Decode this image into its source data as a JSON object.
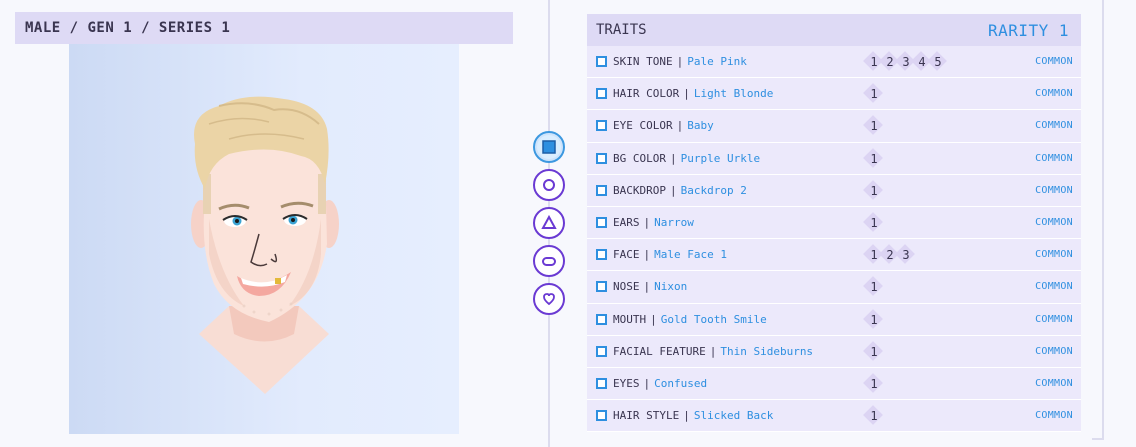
{
  "breadcrumb": "MALE / GEN 1 / SERIES 1",
  "traits_title": "TRAITS",
  "rarity": "RARITY 1",
  "shape_buttons": [
    {
      "name": "square",
      "active": true
    },
    {
      "name": "circle",
      "active": false
    },
    {
      "name": "triangle",
      "active": false
    },
    {
      "name": "pill",
      "active": false
    },
    {
      "name": "heart",
      "active": false
    }
  ],
  "traits": [
    {
      "name": "SKIN TONE",
      "value": "Pale Pink",
      "variants": [
        "1",
        "2",
        "3",
        "4",
        "5"
      ],
      "rarity": "COMMON"
    },
    {
      "name": "HAIR COLOR",
      "value": "Light Blonde",
      "variants": [
        "1"
      ],
      "rarity": "COMMON"
    },
    {
      "name": "EYE COLOR",
      "value": "Baby",
      "variants": [
        "1"
      ],
      "rarity": "COMMON"
    },
    {
      "name": "BG COLOR",
      "value": "Purple Urkle",
      "variants": [
        "1"
      ],
      "rarity": "COMMON"
    },
    {
      "name": "BACKDROP",
      "value": "Backdrop 2",
      "variants": [
        "1"
      ],
      "rarity": "COMMON"
    },
    {
      "name": "EARS",
      "value": "Narrow",
      "variants": [
        "1"
      ],
      "rarity": "COMMON"
    },
    {
      "name": "FACE",
      "value": "Male Face 1",
      "variants": [
        "1",
        "2",
        "3"
      ],
      "rarity": "COMMON"
    },
    {
      "name": "NOSE",
      "value": "Nixon",
      "variants": [
        "1"
      ],
      "rarity": "COMMON"
    },
    {
      "name": "MOUTH",
      "value": "Gold Tooth Smile",
      "variants": [
        "1"
      ],
      "rarity": "COMMON"
    },
    {
      "name": "FACIAL FEATURE",
      "value": "Thin Sideburns",
      "variants": [
        "1"
      ],
      "rarity": "COMMON"
    },
    {
      "name": "EYES",
      "value": "Confused",
      "variants": [
        "1"
      ],
      "rarity": "COMMON"
    },
    {
      "name": "HAIR STYLE",
      "value": "Slicked Back",
      "variants": [
        "1"
      ],
      "rarity": "COMMON"
    }
  ],
  "colors": {
    "accent_blue": "#2e8fe0",
    "accent_purple": "#6a3ad3",
    "header_bg": "#dedaf5",
    "row_bg": "#ece9fb"
  }
}
